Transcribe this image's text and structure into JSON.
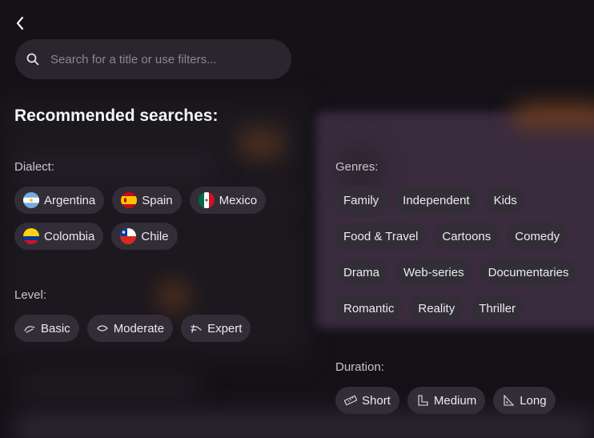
{
  "nav": {
    "back_icon": "chevron-left-icon"
  },
  "search": {
    "placeholder": "Search for a title or use filters...",
    "icon": "search-icon"
  },
  "recommended": {
    "heading": "Recommended searches:"
  },
  "dialect": {
    "label": "Dialect:",
    "items": [
      {
        "label": "Argentina",
        "icon": "argentina-flag-icon"
      },
      {
        "label": "Spain",
        "icon": "spain-flag-icon"
      },
      {
        "label": "Mexico",
        "icon": "mexico-flag-icon"
      },
      {
        "label": "Colombia",
        "icon": "colombia-flag-icon"
      },
      {
        "label": "Chile",
        "icon": "chile-flag-icon"
      }
    ]
  },
  "level": {
    "label": "Level:",
    "items": [
      {
        "label": "Basic",
        "icon": "basic-level-icon"
      },
      {
        "label": "Moderate",
        "icon": "moderate-level-icon"
      },
      {
        "label": "Expert",
        "icon": "expert-level-icon"
      }
    ]
  },
  "genres": {
    "label": "Genres:",
    "items": [
      {
        "label": "Family"
      },
      {
        "label": "Independent"
      },
      {
        "label": "Kids"
      },
      {
        "label": "Food & Travel"
      },
      {
        "label": "Cartoons"
      },
      {
        "label": "Comedy"
      },
      {
        "label": "Drama"
      },
      {
        "label": "Web-series"
      },
      {
        "label": "Documentaries"
      },
      {
        "label": "Romantic"
      },
      {
        "label": "Reality"
      },
      {
        "label": "Thriller"
      }
    ]
  },
  "duration": {
    "label": "Duration:",
    "items": [
      {
        "label": "Short",
        "icon": "short-ruler-icon"
      },
      {
        "label": "Medium",
        "icon": "medium-ruler-icon"
      },
      {
        "label": "Long",
        "icon": "long-ruler-icon"
      }
    ]
  },
  "colors": {
    "background": "#141117",
    "chip": "#322d36",
    "search": "#2a262d"
  }
}
